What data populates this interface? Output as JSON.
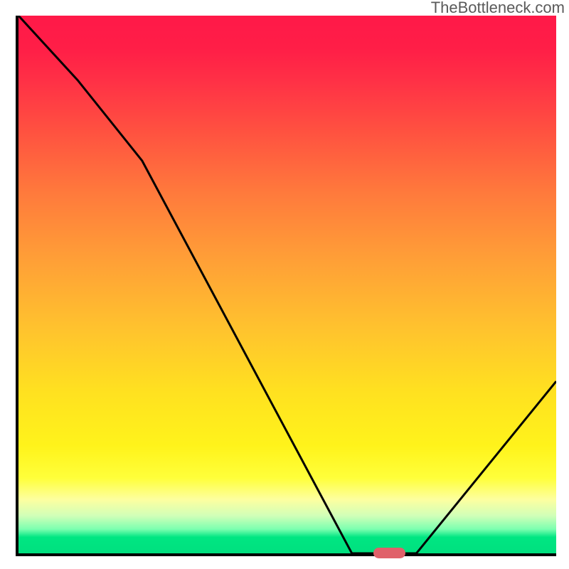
{
  "watermark": "TheBottleneck.com",
  "chart_data": {
    "type": "line",
    "title": "",
    "xlabel": "",
    "ylabel": "",
    "xlim": [
      0,
      100
    ],
    "ylim": [
      0,
      100
    ],
    "grid": false,
    "legend": false,
    "series": [
      {
        "name": "bottleneck-curve",
        "x": [
          0,
          11,
          23,
          62,
          68,
          74,
          100
        ],
        "values": [
          100,
          88,
          73,
          0,
          0,
          0,
          32
        ]
      }
    ],
    "annotations": [
      {
        "name": "optimal-marker",
        "x_start": 66,
        "x_end": 72,
        "y": 0
      }
    ],
    "gradient_stops": [
      {
        "pos": 0,
        "color": "#ff1948"
      },
      {
        "pos": 22,
        "color": "#ff5340"
      },
      {
        "pos": 45,
        "color": "#ff9e37"
      },
      {
        "pos": 70,
        "color": "#ffe120"
      },
      {
        "pos": 90,
        "color": "#fdffa0"
      },
      {
        "pos": 97,
        "color": "#00e682"
      },
      {
        "pos": 100,
        "color": "#00e07f"
      }
    ]
  },
  "colors": {
    "curve": "#000000",
    "marker": "#e0616a",
    "axis": "#000000"
  }
}
